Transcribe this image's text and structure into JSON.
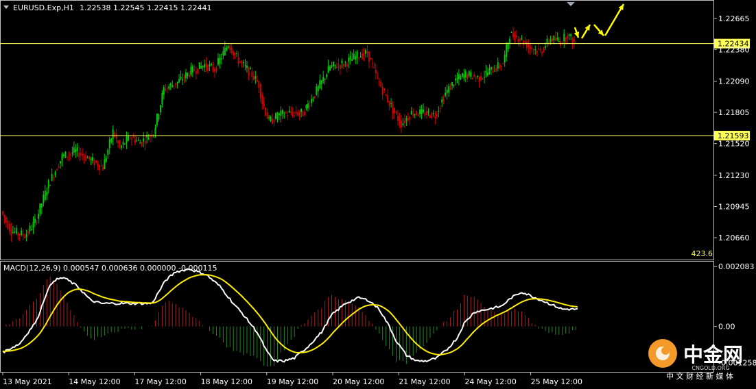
{
  "header": {
    "symbol": "EURUSD.Exp,H1",
    "ohlc": "1.22538 1.22545 1.22415 1.22441"
  },
  "price_axis": {
    "ticks": [
      "1.22665",
      "1.22380",
      "1.22090",
      "1.21805",
      "1.21520",
      "1.21230",
      "1.20945",
      "1.20660"
    ],
    "ylim": [
      1.2046,
      1.2282
    ]
  },
  "levels": [
    {
      "label": "1.22434",
      "value": 1.22434
    },
    {
      "label": "1.21593",
      "value": 1.21593
    }
  ],
  "corner_value": "423.6",
  "macd": {
    "label": "MACD(12,26,9) 0.000547 0.000636 0.000000 -0.000115",
    "ticks": [
      "0.002083",
      "0.00",
      "-0.001258"
    ],
    "ylim": [
      -0.00158,
      0.00223
    ]
  },
  "time_axis": {
    "labels": [
      "13 May 2021",
      "14 May 12:00",
      "17 May 12:00",
      "18 May 12:00",
      "19 May 12:00",
      "20 May 12:00",
      "21 May 12:00",
      "24 May 12:00",
      "25 May 12:00"
    ]
  },
  "watermark": {
    "name": "中金网",
    "site": "CNGOLD.ORG",
    "tagline": "中 文 财 经 新 媒 体"
  },
  "colors": {
    "bull": "#00cc00",
    "bear": "#d00000",
    "level_line": "#ffff66",
    "macd_line": "#ffffff",
    "signal_line": "#ffee00",
    "arrow": "#ffff00",
    "frame": "#c0c0c0"
  },
  "chart_data": {
    "type": "candlestick",
    "title": "EURUSD.Exp,H1",
    "anchors": [
      [
        0,
        1.209
      ],
      [
        6,
        1.2072
      ],
      [
        14,
        1.2068
      ],
      [
        20,
        1.208
      ],
      [
        28,
        1.2115
      ],
      [
        36,
        1.214
      ],
      [
        44,
        1.2145
      ],
      [
        52,
        1.2138
      ],
      [
        60,
        1.213
      ],
      [
        66,
        1.2163
      ],
      [
        70,
        1.2148
      ],
      [
        76,
        1.2158
      ],
      [
        82,
        1.2153
      ],
      [
        90,
        1.2162
      ],
      [
        96,
        1.2202
      ],
      [
        104,
        1.2208
      ],
      [
        112,
        1.2218
      ],
      [
        120,
        1.2224
      ],
      [
        126,
        1.222
      ],
      [
        134,
        1.2243
      ],
      [
        140,
        1.2228
      ],
      [
        148,
        1.2215
      ],
      [
        152,
        1.2206
      ],
      [
        154,
        1.219
      ],
      [
        158,
        1.2172
      ],
      [
        164,
        1.2178
      ],
      [
        170,
        1.218
      ],
      [
        178,
        1.218
      ],
      [
        186,
        1.22
      ],
      [
        194,
        1.2222
      ],
      [
        202,
        1.2225
      ],
      [
        210,
        1.2232
      ],
      [
        216,
        1.2235
      ],
      [
        222,
        1.221
      ],
      [
        226,
        1.2198
      ],
      [
        232,
        1.218
      ],
      [
        236,
        1.217
      ],
      [
        242,
        1.218
      ],
      [
        250,
        1.218
      ],
      [
        256,
        1.2178
      ],
      [
        262,
        1.2198
      ],
      [
        268,
        1.221
      ],
      [
        274,
        1.2215
      ],
      [
        282,
        1.2212
      ],
      [
        290,
        1.222
      ],
      [
        296,
        1.2225
      ],
      [
        300,
        1.2252
      ],
      [
        306,
        1.2248
      ],
      [
        312,
        1.224
      ],
      [
        318,
        1.2236
      ],
      [
        324,
        1.2248
      ],
      [
        330,
        1.2245
      ],
      [
        334,
        1.2252
      ],
      [
        338,
        1.2244
      ]
    ],
    "macd_anchors": [
      [
        0,
        -0.0009
      ],
      [
        10,
        -0.0006
      ],
      [
        20,
        0.0002
      ],
      [
        26,
        0.0012
      ],
      [
        30,
        0.0016
      ],
      [
        36,
        0.0017
      ],
      [
        44,
        0.0014
      ],
      [
        52,
        0.0009
      ],
      [
        58,
        0.0008
      ],
      [
        64,
        0.0008
      ],
      [
        72,
        0.0008
      ],
      [
        80,
        0.0008
      ],
      [
        88,
        0.0008
      ],
      [
        96,
        0.0016
      ],
      [
        102,
        0.0019
      ],
      [
        110,
        0.002
      ],
      [
        120,
        0.0018
      ],
      [
        128,
        0.0014
      ],
      [
        136,
        0.0008
      ],
      [
        142,
        0.0004
      ],
      [
        150,
        -0.0002
      ],
      [
        156,
        -0.0009
      ],
      [
        160,
        -0.0012
      ],
      [
        166,
        -0.0012
      ],
      [
        172,
        -0.0011
      ],
      [
        180,
        -0.0007
      ],
      [
        188,
        -0.0002
      ],
      [
        194,
        0.0004
      ],
      [
        202,
        0.0008
      ],
      [
        210,
        0.001
      ],
      [
        216,
        0.0009
      ],
      [
        222,
        0.0006
      ],
      [
        228,
        0.0
      ],
      [
        232,
        -0.0005
      ],
      [
        238,
        -0.001
      ],
      [
        244,
        -0.0012
      ],
      [
        250,
        -0.0012
      ],
      [
        256,
        -0.0011
      ],
      [
        262,
        -0.0008
      ],
      [
        268,
        -0.0004
      ],
      [
        272,
        0.0001
      ],
      [
        278,
        0.0005
      ],
      [
        286,
        0.0006
      ],
      [
        294,
        0.0007
      ],
      [
        300,
        0.001
      ],
      [
        306,
        0.0012
      ],
      [
        314,
        0.001
      ],
      [
        322,
        0.0008
      ],
      [
        330,
        0.0006
      ],
      [
        338,
        0.0006
      ]
    ],
    "ylim": [
      1.2046,
      1.2282
    ],
    "grid": false
  }
}
